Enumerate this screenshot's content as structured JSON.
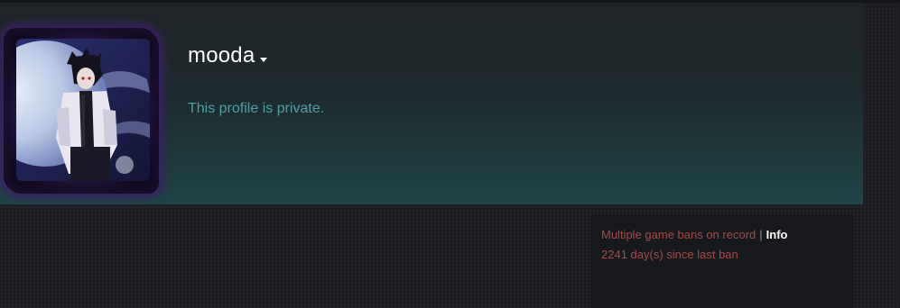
{
  "profile": {
    "persona_name": "mooda",
    "private_message": "This profile is private."
  },
  "ban_status": {
    "bans_text": "Multiple game bans on record",
    "separator": "|",
    "info_link": "Info",
    "days_since_text": "2241 day(s) since last ban"
  },
  "colors": {
    "name": "#ffffff",
    "private_text": "#4aa3a7",
    "ban_text": "#a44a4a",
    "avatar_glow": "#3d1e6d"
  },
  "icons": {
    "persona_dropdown": "caret-down-icon"
  }
}
